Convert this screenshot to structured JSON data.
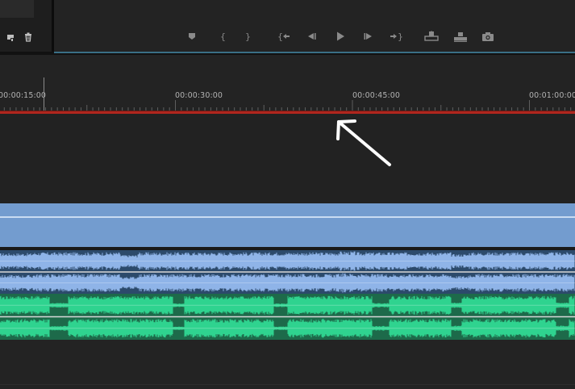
{
  "panel": {
    "left_icons": [
      "new-item-icon",
      "trash-icon"
    ]
  },
  "transport": {
    "buttons": [
      {
        "name": "add-marker-button",
        "icon": "marker-icon"
      },
      {
        "name": "mark-in-button",
        "icon": "mark-in-icon"
      },
      {
        "name": "mark-out-button",
        "icon": "mark-out-icon"
      },
      {
        "name": "go-to-in-button",
        "icon": "go-to-in-icon"
      },
      {
        "name": "step-back-button",
        "icon": "step-back-icon"
      },
      {
        "name": "play-button",
        "icon": "play-icon"
      },
      {
        "name": "step-forward-button",
        "icon": "step-forward-icon"
      },
      {
        "name": "go-to-out-button",
        "icon": "go-to-out-icon"
      },
      {
        "name": "lift-button",
        "icon": "lift-icon"
      },
      {
        "name": "extract-button",
        "icon": "extract-icon"
      },
      {
        "name": "export-frame-button",
        "icon": "camera-icon"
      }
    ]
  },
  "timeline": {
    "timecodes": [
      "00:00:15:00",
      "00:00:30:00",
      "00:00:45:00",
      "00:01:00:00"
    ]
  },
  "colors": {
    "background": "#202020",
    "work_area_bar": "#b0261e",
    "video_clip": "#739ccf",
    "audio_clip_1": "#2c4a6b",
    "audio_wave_1": "#8fb4e8",
    "audio_clip_2": "#1d6a4a",
    "audio_wave_2": "#2fd38f",
    "annotation_arrow": "#ffffff"
  }
}
